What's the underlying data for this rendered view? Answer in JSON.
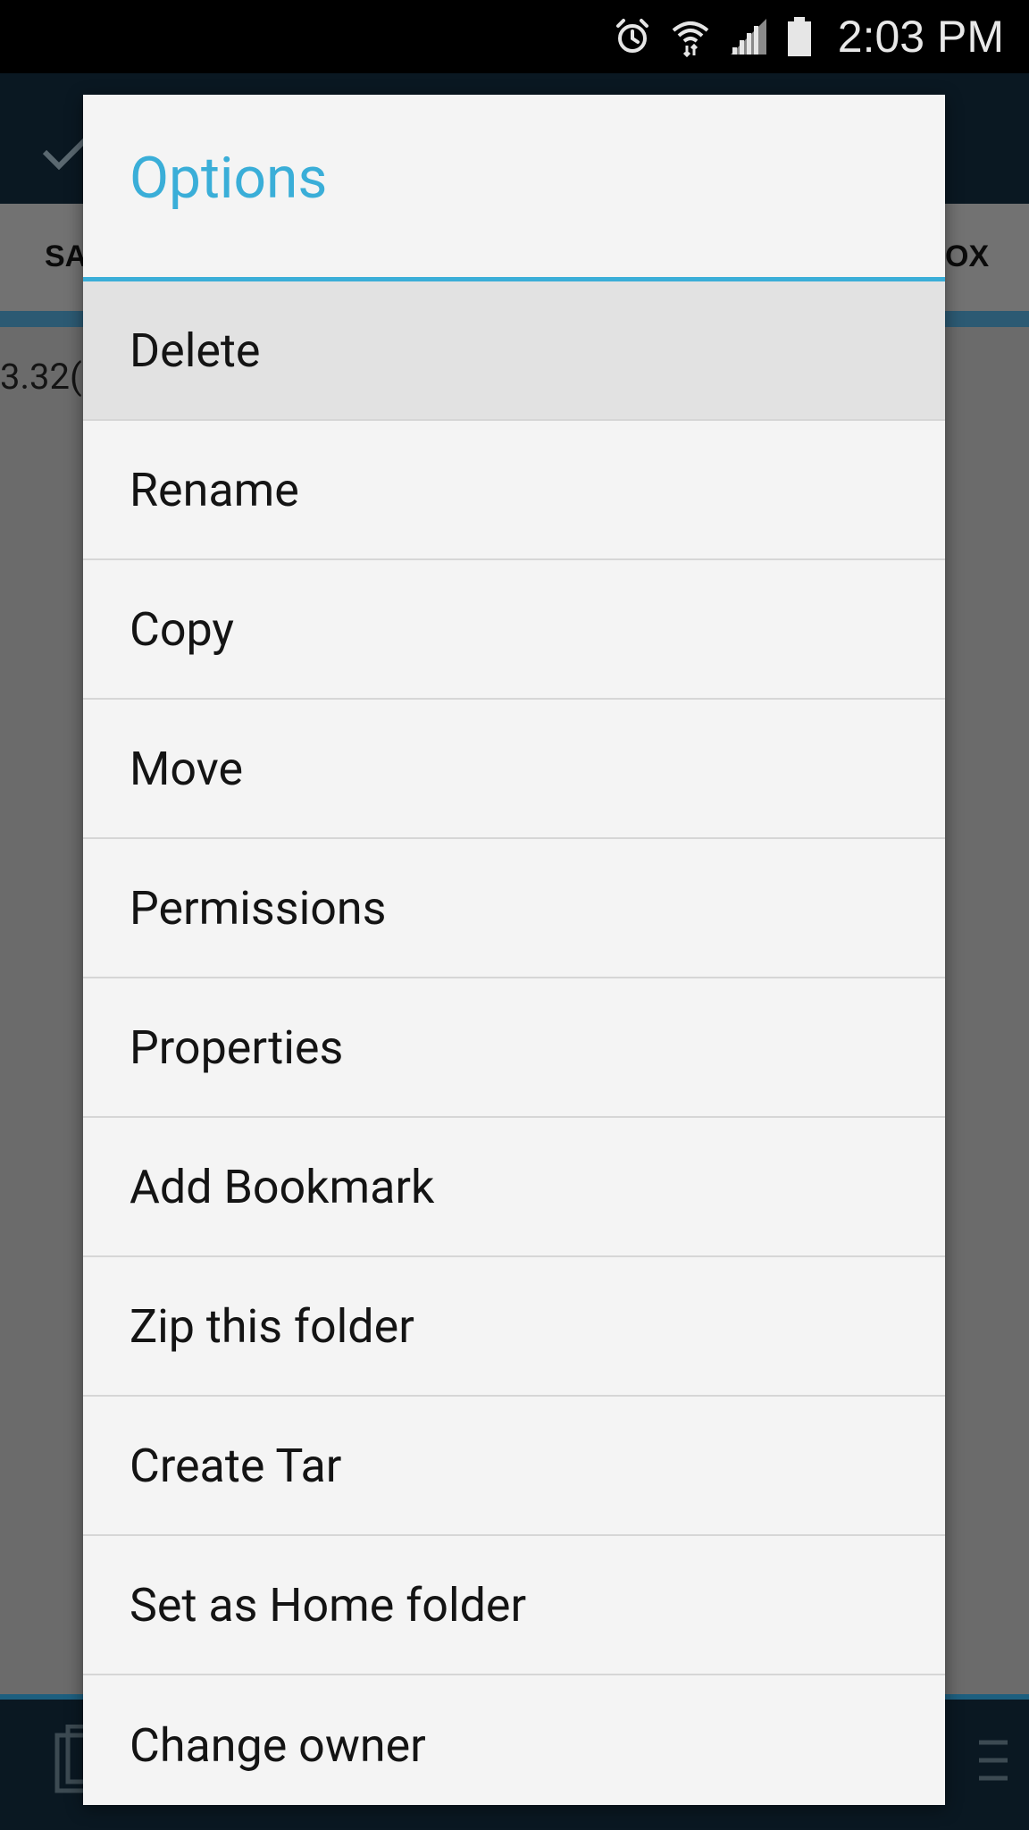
{
  "status_bar": {
    "time": "2:03 PM",
    "icons": [
      "alarm-icon",
      "wifi-icon",
      "signal-icon",
      "battery-icon"
    ]
  },
  "background_app": {
    "tabs": [
      "SA",
      "OX"
    ],
    "content_text": "3.32("
  },
  "dialog": {
    "title": "Options",
    "options": [
      {
        "label": "Delete",
        "highlighted": true
      },
      {
        "label": "Rename"
      },
      {
        "label": "Copy"
      },
      {
        "label": "Move"
      },
      {
        "label": "Permissions"
      },
      {
        "label": "Properties"
      },
      {
        "label": "Add Bookmark"
      },
      {
        "label": "Zip this folder"
      },
      {
        "label": "Create Tar"
      },
      {
        "label": "Set as Home folder"
      },
      {
        "label": "Change owner"
      }
    ]
  },
  "colors": {
    "accent": "#3aaed8",
    "highlight_row": "#e2e2e2",
    "dialog_bg": "#f4f4f4"
  }
}
